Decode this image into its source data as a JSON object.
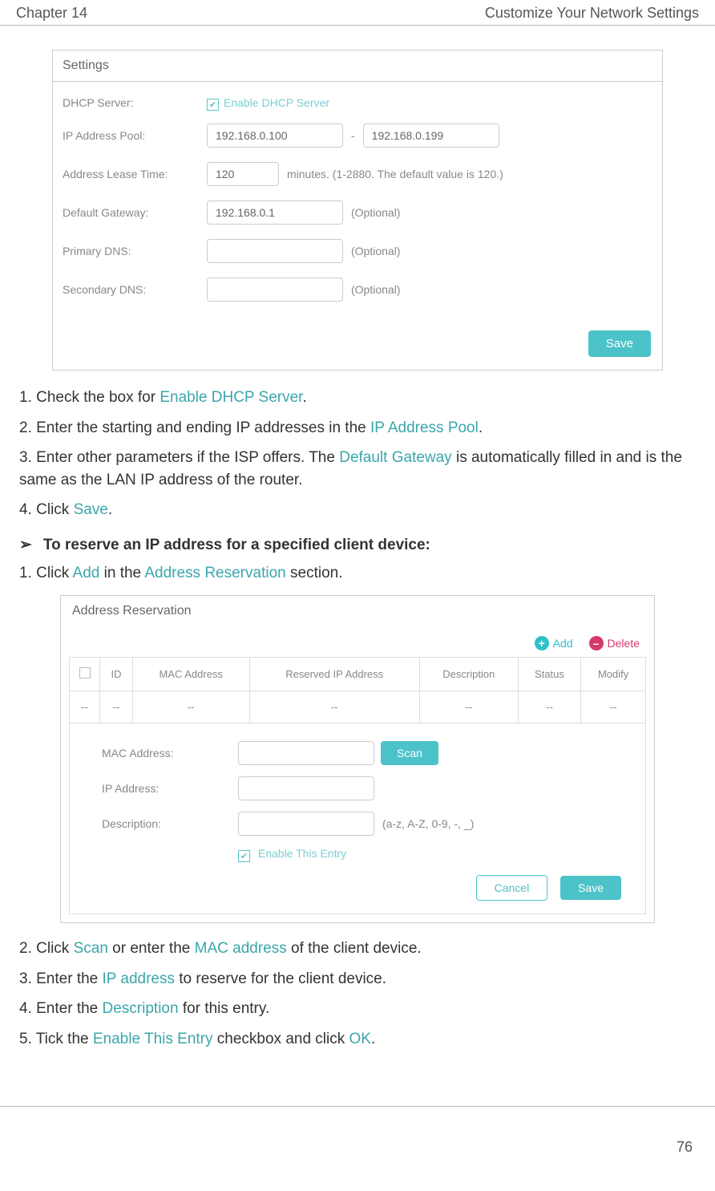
{
  "header": {
    "chapter": "Chapter 14",
    "title": "Customize Your Network Settings"
  },
  "settings_panel": {
    "title": "Settings",
    "dhcp_label": "DHCP Server:",
    "dhcp_checkbox_label": "Enable DHCP Server",
    "pool_label": "IP Address Pool:",
    "pool_start": "192.168.0.100",
    "pool_end": "192.168.0.199",
    "pool_dash": "-",
    "lease_label": "Address Lease Time:",
    "lease_value": "120",
    "lease_hint": "minutes. (1-2880. The default value is 120.)",
    "gateway_label": "Default Gateway:",
    "gateway_value": "192.168.0.1",
    "optional": "(Optional)",
    "pdns_label": "Primary DNS:",
    "sdns_label": "Secondary DNS:",
    "save": "Save"
  },
  "steps_a": {
    "s1a": "1. Check the box for ",
    "s1b": "Enable DHCP Server",
    "s1c": ".",
    "s2a": "2. Enter the starting and ending IP addresses in the ",
    "s2b": "IP Address Pool",
    "s2c": ".",
    "s3a": "3. Enter other parameters if the ISP offers. The ",
    "s3b": "Default Gateway",
    "s3c": " is automatically filled in and is the same as the LAN IP address of the router.",
    "s4a": "4. Click ",
    "s4b": "Save",
    "s4c": "."
  },
  "subhead": {
    "arrow": "➢",
    "text": "To reserve an IP address for a specified client device:"
  },
  "steps_b": {
    "s1a": "1. Click ",
    "s1b": "Add",
    "s1c": " in the ",
    "s1d": "Address Reservation",
    "s1e": " section."
  },
  "reservation_panel": {
    "title": "Address Reservation",
    "add": "Add",
    "delete": "Delete",
    "cols": {
      "id": "ID",
      "mac": "MAC Address",
      "ip": "Reserved IP Address",
      "desc": "Description",
      "status": "Status",
      "modify": "Modify"
    },
    "empty": "--",
    "form": {
      "mac_label": "MAC Address:",
      "ip_label": "IP Address:",
      "desc_label": "Description:",
      "desc_hint": "(a-z, A-Z, 0-9, -, _)",
      "scan": "Scan",
      "enable": "Enable This Entry",
      "cancel": "Cancel",
      "save": "Save"
    }
  },
  "steps_c": {
    "s2a": "2. Click ",
    "s2b": "Scan",
    "s2c": " or enter the ",
    "s2d": "MAC address",
    "s2e": " of the client device.",
    "s3a": "3. Enter the ",
    "s3b": "IP address",
    "s3c": " to reserve for the client device.",
    "s4a": "4. Enter the ",
    "s4b": "Description",
    "s4c": " for this entry.",
    "s5a": "5. Tick the ",
    "s5b": "Enable This Entry",
    "s5c": " checkbox and click ",
    "s5d": "OK",
    "s5e": "."
  },
  "page_number": "76"
}
